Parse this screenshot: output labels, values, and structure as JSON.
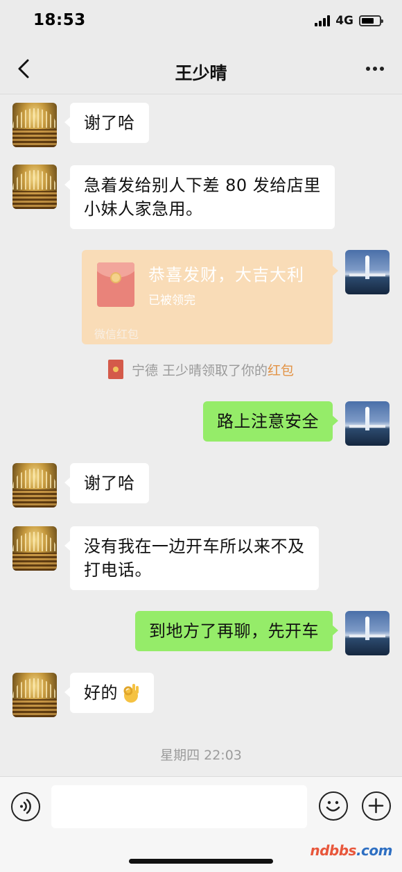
{
  "status_bar": {
    "time": "18:53",
    "network": "4G"
  },
  "nav": {
    "title": "王少晴"
  },
  "messages": [
    {
      "text": "谢了哈"
    },
    {
      "line1": "急着发给别人下差 80 发给店里",
      "line2": "小妹人家急用。"
    },
    {
      "red_packet": {
        "title": "恭喜发财，大吉大利",
        "status": "已被领完",
        "label": "微信红包"
      }
    },
    {
      "text": "路上注意安全"
    },
    {
      "text": "谢了哈"
    },
    {
      "line1": "没有我在一边开车所以来不及",
      "line2": "打电话。"
    },
    {
      "text": "到地方了再聊，先开车"
    },
    {
      "text": "好的"
    }
  ],
  "system_note": {
    "prefix": "宁德 王少晴领取了你的",
    "link": "红包"
  },
  "timestamp": "星期四 22:03",
  "watermark": {
    "brand": "ndbbs",
    "domain": ".com"
  },
  "colors": {
    "outgoing_bubble": "#95ec69",
    "incoming_bubble": "#ffffff",
    "background": "#ededed",
    "red_packet": "#f9dcb7"
  },
  "icons": [
    "back-icon",
    "more-icon",
    "voice-icon",
    "emoji-icon",
    "plus-icon",
    "red-packet-icon",
    "ok-hand-emoji"
  ]
}
